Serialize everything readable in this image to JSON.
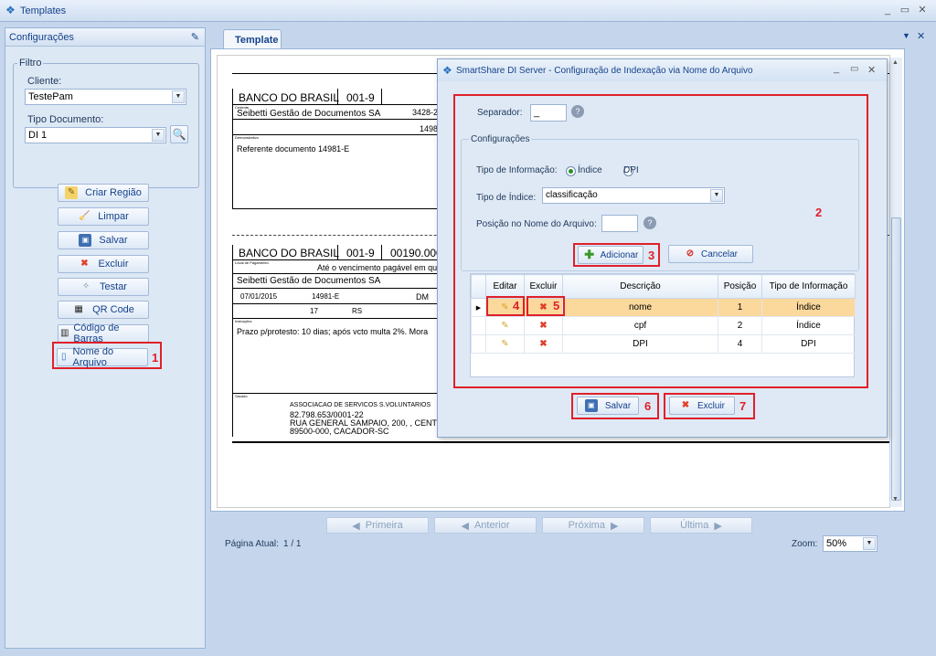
{
  "app": {
    "title": "Templates"
  },
  "left_panel": {
    "title": "Configurações",
    "filter_legend": "Filtro",
    "client_label": "Cliente:",
    "client_value": "TestePam",
    "doctype_label": "Tipo Documento:",
    "doctype_value": "DI 1",
    "buttons": {
      "create_region": "Criar Região",
      "clear": "Limpar",
      "save": "Salvar",
      "delete": "Excluir",
      "test": "Testar",
      "qr": "QR Code",
      "barcode": "Código de Barras",
      "filename": "Nome do Arquivo"
    },
    "callout_1": "1"
  },
  "tab": {
    "label": "Template"
  },
  "document": {
    "bank1": "BANCO DO BRASIL",
    "code1": "001-9",
    "payee_lbl": "Cedente",
    "payee": "Seibetti Gestão de Documentos SA",
    "agency": "3428-2",
    "docnum": "1498",
    "desc_lbl": "Demonstrativo",
    "desc": "Referente documento 14981-E",
    "bank2": "BANCO DO BRASIL",
    "code2": "001-9",
    "line_code": "00190.000",
    "place_lbl": "Local de Pagamento",
    "place": "Até o vencimento pagável em qu",
    "payee2": "Seibetti Gestão de Documentos SA",
    "date": "07/01/2015",
    "doc_no": "14981-E",
    "species": "DM",
    "n17": "17",
    "rs": "RS",
    "instr_lbl": "Instruções",
    "instr": "Prazo p/protesto: 10 dias; após vcto multa 2%.   Mora",
    "drawee_lbl": "Sacado",
    "drawee1": "ASSOCIACAO DE SERVICOS S.VOLUNTARIOS",
    "drawee2": "82.798.653/0001-22",
    "drawee3": "RUA GENERAL SAMPAIO, 200, , CENT",
    "drawee4": "89500-000, CACADOR-SC"
  },
  "dialog": {
    "title": "SmartShare DI Server - Configuração de Indexação via Nome do Arquivo",
    "separator_label": "Separador:",
    "separator_value": "_",
    "config_legend": "Configurações",
    "info_type_label": "Tipo de Informação:",
    "radio_index": "Índice",
    "radio_dpi": "DPI",
    "index_type_label": "Tipo de Índice:",
    "index_type_value": "classificação",
    "position_label": "Posição no Nome do Arquivo:",
    "position_value": "",
    "add_button": "Adicionar",
    "cancel_button": "Cancelar",
    "grid_headers": [
      "Editar",
      "Excluir",
      "Descrição",
      "Posição",
      "Tipo de Informação"
    ],
    "rows": [
      {
        "descricao": "nome",
        "posicao": "1",
        "tipo": "Índice"
      },
      {
        "descricao": "cpf",
        "posicao": "2",
        "tipo": "Índice"
      },
      {
        "descricao": "DPI",
        "posicao": "4",
        "tipo": "DPI"
      }
    ],
    "save_button": "Salvar",
    "delete_button": "Excluir",
    "callouts": {
      "c2": "2",
      "c3": "3",
      "c4": "4",
      "c5": "5",
      "c6": "6",
      "c7": "7"
    }
  },
  "pager": {
    "first": "Primeira",
    "prev": "Anterior",
    "next": "Próxima",
    "last": "Última",
    "current_label": "Página Atual:",
    "current_value": "1 / 1",
    "zoom_label": "Zoom:",
    "zoom_value": "50%"
  }
}
